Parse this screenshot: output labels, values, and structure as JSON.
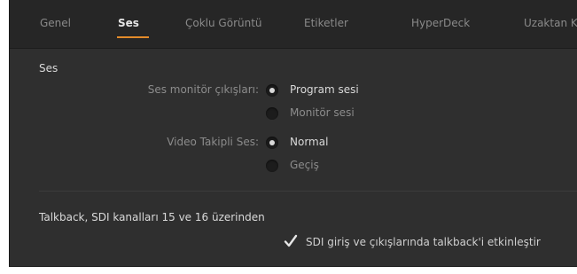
{
  "tabs": [
    {
      "label": "Genel",
      "active": false
    },
    {
      "label": "Ses",
      "active": true
    },
    {
      "label": "Çoklu Görüntü",
      "active": false
    },
    {
      "label": "Etiketler",
      "active": false
    },
    {
      "label": "HyperDeck",
      "active": false
    },
    {
      "label": "Uzaktan K",
      "active": false
    }
  ],
  "accent_color": "#e38b2a",
  "audio_section": {
    "title": "Ses",
    "monitor_outputs": {
      "label": "Ses monitör çıkışları:",
      "options": [
        {
          "label": "Program sesi",
          "selected": true
        },
        {
          "label": "Monitör sesi",
          "selected": false
        }
      ]
    },
    "audio_follow_video": {
      "label": "Video Takipli Ses:",
      "options": [
        {
          "label": "Normal",
          "selected": true
        },
        {
          "label": "Geçiş",
          "selected": false
        }
      ]
    }
  },
  "talkback_section": {
    "title": "Talkback, SDI kanalları 15 ve 16 üzerinden",
    "checkbox": {
      "label": "SDI giriş ve çıkışlarında talkback'i etkinleştir",
      "checked": true,
      "icon": "checkmark-icon"
    }
  }
}
